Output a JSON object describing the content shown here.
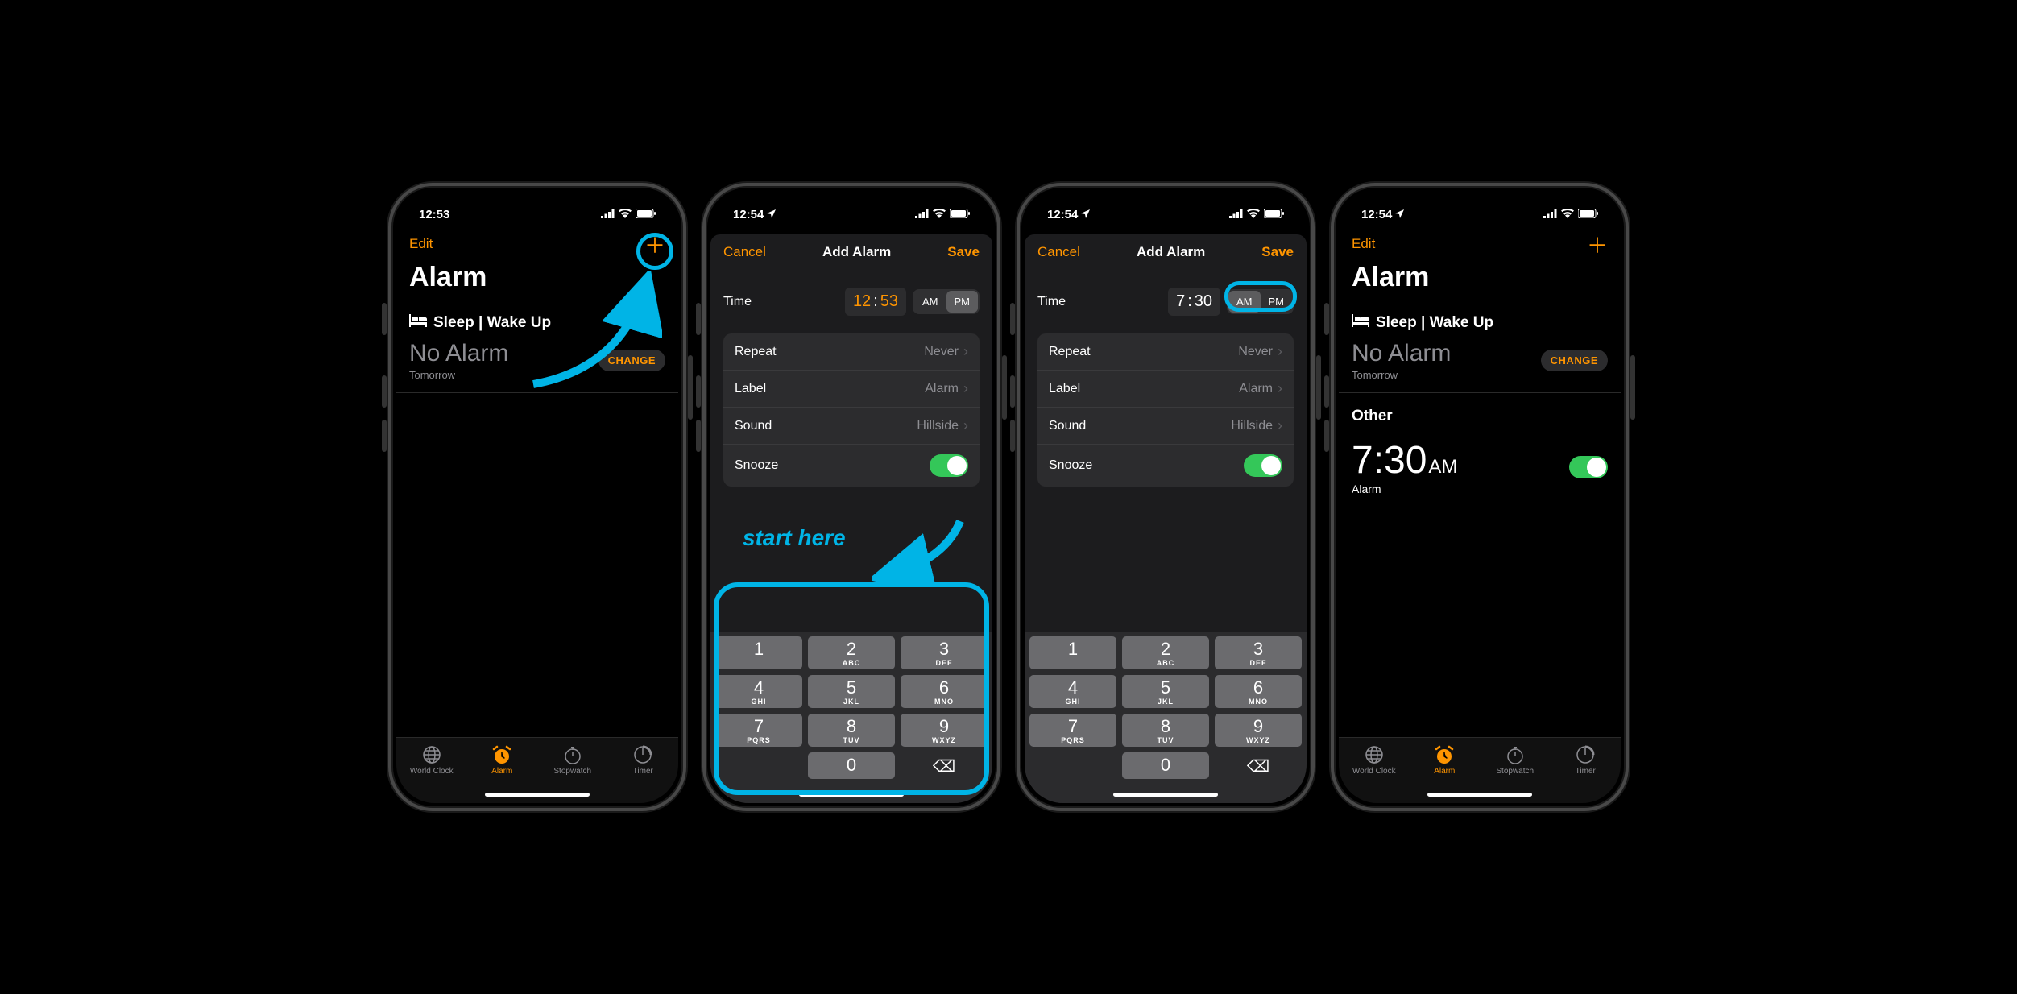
{
  "annotations": {
    "start_here": "start here"
  },
  "colors": {
    "accent": "#ff9500",
    "annotation": "#00b4e6",
    "toggle_on": "#34c759"
  },
  "keypad": {
    "keys": [
      {
        "num": "1",
        "sub": ""
      },
      {
        "num": "2",
        "sub": "ABC"
      },
      {
        "num": "3",
        "sub": "DEF"
      },
      {
        "num": "4",
        "sub": "GHI"
      },
      {
        "num": "5",
        "sub": "JKL"
      },
      {
        "num": "6",
        "sub": "MNO"
      },
      {
        "num": "7",
        "sub": "PQRS"
      },
      {
        "num": "8",
        "sub": "TUV"
      },
      {
        "num": "9",
        "sub": "WXYZ"
      },
      {
        "num": "",
        "sub": "",
        "blank": true
      },
      {
        "num": "0",
        "sub": ""
      },
      {
        "num": "⌫",
        "sub": "",
        "del": true
      }
    ]
  },
  "tabs": [
    {
      "label": "World Clock",
      "active": false,
      "icon": "globe"
    },
    {
      "label": "Alarm",
      "active": true,
      "icon": "alarm"
    },
    {
      "label": "Stopwatch",
      "active": false,
      "icon": "stopwatch"
    },
    {
      "label": "Timer",
      "active": false,
      "icon": "timer"
    }
  ],
  "screens": [
    {
      "type": "alarm-list",
      "status_time": "12:53",
      "nav": {
        "left": "Edit",
        "center": "",
        "right_icon": "plus"
      },
      "title": "Alarm",
      "sleep": {
        "header": "Sleep | Wake Up",
        "text": "No Alarm",
        "sub": "Tomorrow",
        "btn": "CHANGE"
      },
      "circle_plus": true
    },
    {
      "type": "add-alarm",
      "status_time": "12:54",
      "nav": {
        "left": "Cancel",
        "center": "Add Alarm",
        "right": "Save"
      },
      "time": {
        "label": "Time",
        "hour": "12",
        "minute": "53",
        "am": "AM",
        "pm": "PM",
        "hm_highlight": true,
        "ampm_selected": "PM"
      },
      "options": [
        {
          "label": "Repeat",
          "value": "Never",
          "chevron": true
        },
        {
          "label": "Label",
          "value": "Alarm",
          "chevron": true
        },
        {
          "label": "Sound",
          "value": "Hillside",
          "chevron": true
        },
        {
          "label": "Snooze",
          "toggle": true
        }
      ],
      "start_here": true,
      "keypad_highlight": true
    },
    {
      "type": "add-alarm",
      "status_time": "12:54",
      "nav": {
        "left": "Cancel",
        "center": "Add Alarm",
        "right": "Save"
      },
      "time": {
        "label": "Time",
        "hour": "7",
        "minute": "30",
        "am": "AM",
        "pm": "PM",
        "hm_highlight": false,
        "ampm_selected": "AM"
      },
      "options": [
        {
          "label": "Repeat",
          "value": "Never",
          "chevron": true
        },
        {
          "label": "Label",
          "value": "Alarm",
          "chevron": true
        },
        {
          "label": "Sound",
          "value": "Hillside",
          "chevron": true
        },
        {
          "label": "Snooze",
          "toggle": true
        }
      ],
      "ampm_highlight": true
    },
    {
      "type": "alarm-list",
      "status_time": "12:54",
      "nav": {
        "left": "Edit",
        "center": "",
        "right_icon": "plus"
      },
      "title": "Alarm",
      "sleep": {
        "header": "Sleep | Wake Up",
        "text": "No Alarm",
        "sub": "Tomorrow",
        "btn": "CHANGE"
      },
      "other": {
        "header": "Other",
        "time": "7:30",
        "ampm": "AM",
        "label": "Alarm",
        "toggle": true
      }
    }
  ]
}
